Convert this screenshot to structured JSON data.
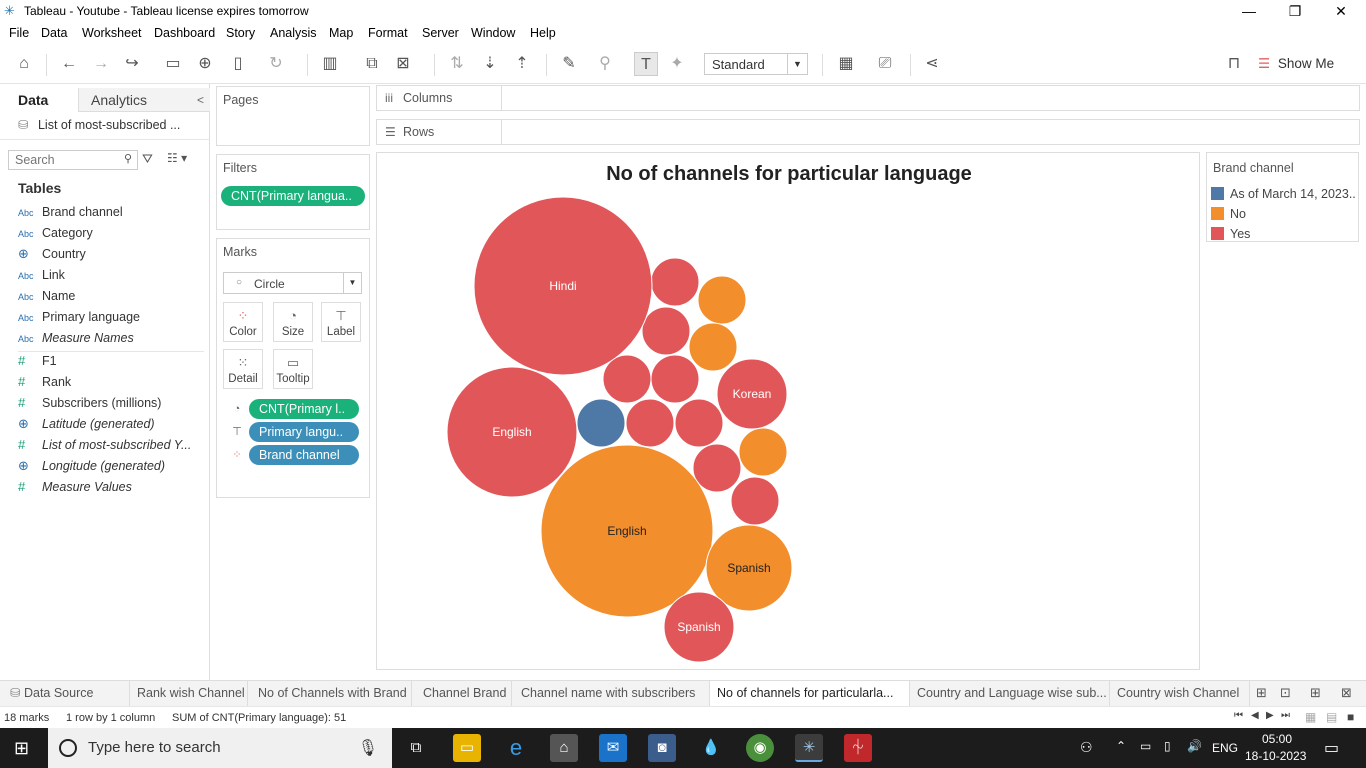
{
  "window": {
    "title": "Tableau - Youtube - Tableau license expires tomorrow",
    "minimize": "—",
    "restore": "❐",
    "close": "✕"
  },
  "menu": [
    "File",
    "Data",
    "Worksheet",
    "Dashboard",
    "Story",
    "Analysis",
    "Map",
    "Format",
    "Server",
    "Window",
    "Help"
  ],
  "toolbar": {
    "fit_value": "Standard",
    "show_me": "Show Me"
  },
  "data_pane": {
    "tab_data": "Data",
    "tab_analytics": "Analytics",
    "collapse": "<",
    "datasource": "List of most-subscribed ...",
    "search_placeholder": "Search",
    "tables_header": "Tables",
    "fields": [
      {
        "type": "Abc",
        "name": "Brand channel",
        "italic": false
      },
      {
        "type": "Abc",
        "name": "Category",
        "italic": false
      },
      {
        "type": "geo",
        "name": "Country",
        "italic": false
      },
      {
        "type": "Abc",
        "name": "Link",
        "italic": false
      },
      {
        "type": "Abc",
        "name": "Name",
        "italic": false
      },
      {
        "type": "Abc",
        "name": "Primary language",
        "italic": false
      },
      {
        "type": "Abc",
        "name": "Measure Names",
        "italic": true
      },
      {
        "type": "#",
        "name": "F1",
        "italic": false
      },
      {
        "type": "#",
        "name": "Rank",
        "italic": false
      },
      {
        "type": "#",
        "name": "Subscribers (millions)",
        "italic": false
      },
      {
        "type": "geo",
        "name": "Latitude (generated)",
        "italic": true
      },
      {
        "type": "#",
        "name": "List of most-subscribed Y...",
        "italic": true
      },
      {
        "type": "geo",
        "name": "Longitude (generated)",
        "italic": true
      },
      {
        "type": "#",
        "name": "Measure Values",
        "italic": true
      }
    ]
  },
  "shelves": {
    "pages": "Pages",
    "filters": "Filters",
    "filter_pill": "CNT(Primary langua..",
    "marks": "Marks",
    "mark_type": "Circle",
    "mark_buttons": [
      "Color",
      "Size",
      "Label",
      "Detail",
      "Tooltip"
    ],
    "mark_pills": [
      "CNT(Primary l..",
      "Primary langu..",
      "Brand channel"
    ],
    "columns": "Columns",
    "rows": "Rows"
  },
  "viz": {
    "title": "No of channels for particular language"
  },
  "legend": {
    "title": "Brand channel",
    "items": [
      {
        "label": "As of March 14, 2023..",
        "color": "#4e79a7"
      },
      {
        "label": "No",
        "color": "#f28e2b"
      },
      {
        "label": "Yes",
        "color": "#e15759"
      }
    ]
  },
  "chart_data": {
    "type": "packed-bubble",
    "title": "No of channels for particular language",
    "size_measure": "CNT(Primary language)",
    "color_dimension": "Brand channel",
    "label_dimension": "Primary language",
    "total": 51,
    "marks_count": 18,
    "labeled_bubbles": [
      {
        "label": "Hindi",
        "brand": "Yes"
      },
      {
        "label": "English",
        "brand": "Yes"
      },
      {
        "label": "English",
        "brand": "No"
      },
      {
        "label": "Korean",
        "brand": "Yes"
      },
      {
        "label": "Spanish",
        "brand": "No"
      },
      {
        "label": "Spanish",
        "brand": "Yes"
      }
    ],
    "unlabeled_brand_counts": {
      "Yes": 8,
      "No": 3,
      "As of March 14, 2023..": 1
    }
  },
  "sheet_tabs": {
    "datasource": "Data Source",
    "sheets": [
      "Rank wish Channel",
      "No of Channels with Brand",
      "Channel Brand",
      "Channel name with subscribers",
      "No of channels for particularla...",
      "Country and Language wise sub...",
      "Country wish Channel"
    ],
    "active_index": 4
  },
  "status": {
    "marks": "18 marks",
    "dims": "1 row by 1 column",
    "sum": "SUM of CNT(Primary language): 51"
  },
  "taskbar": {
    "search_placeholder": "Type here to search",
    "lang": "ENG",
    "time": "05:00",
    "date": "18-10-2023"
  }
}
